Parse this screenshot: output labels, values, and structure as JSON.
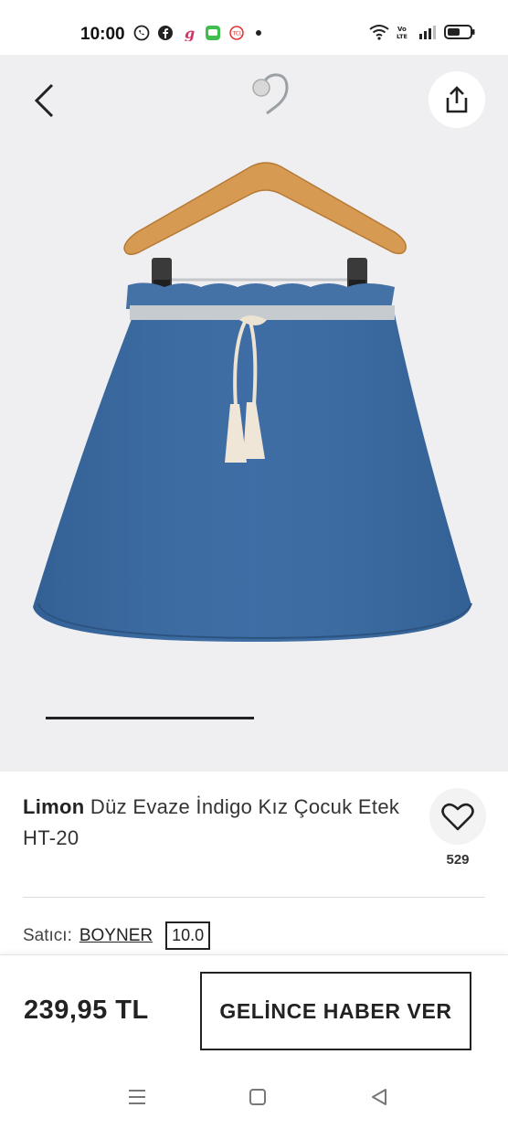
{
  "status_bar": {
    "time": "10:00",
    "left_icons": [
      "whatsapp-icon",
      "facebook-icon",
      "app-j-icon",
      "messages-icon",
      "notification-app-icon"
    ],
    "right_icons": [
      "wifi-icon",
      "volte-icon",
      "signal-icon",
      "battery-icon"
    ],
    "volte_label": "Vo LTE"
  },
  "product_image": {
    "description_icon": "skirt-photo",
    "carousel": {
      "current_index": 0,
      "total": 2
    }
  },
  "product": {
    "brand": "Limon",
    "name": " Düz Evaze İndigo Kız Çocuk Etek  HT-20",
    "favorite_count": "529"
  },
  "seller": {
    "label": "Satıcı:",
    "name": "BOYNER",
    "score": "10.0"
  },
  "action_bar": {
    "price": "239,95 TL",
    "notify_label": "GELİNCE HABER VER"
  },
  "colors": {
    "accent": "#222222",
    "background_image": "#efeff1",
    "denim": "#3a6aa0"
  }
}
